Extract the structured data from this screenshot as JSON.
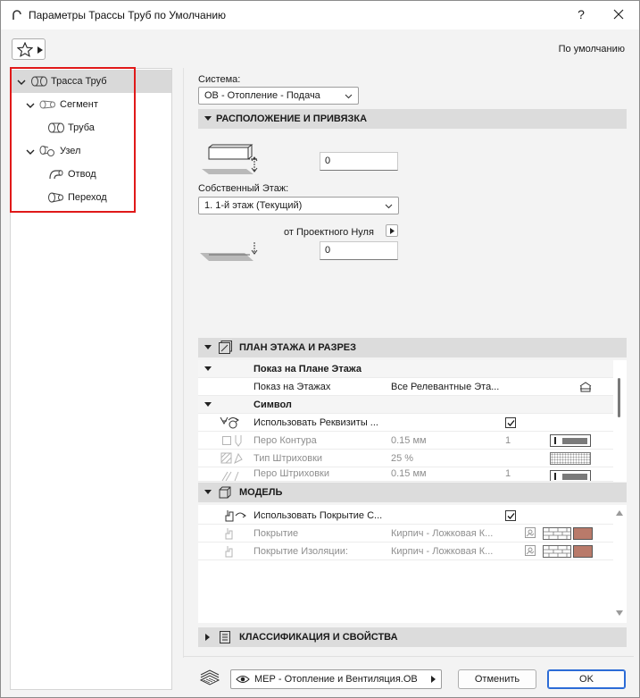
{
  "window": {
    "title": "Параметры Трассы Труб по Умолчанию",
    "help_label": "?"
  },
  "header": {
    "default_label": "По умолчанию"
  },
  "tree": {
    "items": [
      {
        "label": "Трасса Труб",
        "level": 0,
        "expanded": true,
        "selected": true
      },
      {
        "label": "Сегмент",
        "level": 1,
        "expanded": true,
        "selected": false
      },
      {
        "label": "Труба",
        "level": 2,
        "expanded": false,
        "selected": false
      },
      {
        "label": "Узел",
        "level": 1,
        "expanded": true,
        "selected": false
      },
      {
        "label": "Отвод",
        "level": 2,
        "expanded": false,
        "selected": false
      },
      {
        "label": "Переход",
        "level": 2,
        "expanded": false,
        "selected": false
      }
    ]
  },
  "system": {
    "label": "Система:",
    "value": "ОВ - Отопление - Подача"
  },
  "placement": {
    "title": "РАСПОЛОЖЕНИЕ И ПРИВЯЗКА",
    "offset_value": "0",
    "home_story_label": "Собственный Этаж:",
    "home_story_value": "1. 1-й этаж (Текущий)",
    "reference_label": "от Проектного Нуля",
    "reference_value": "0"
  },
  "floor_plan": {
    "title": "ПЛАН ЭТАЖА И РАЗРЕЗ",
    "group1": "Показ на Плане Этажа",
    "show_on_stories_label": "Показ на Этажах",
    "show_on_stories_value": "Все Релевантные Эта...",
    "group2": "Символ",
    "use_attrs_label": "Использовать Реквизиты ...",
    "contour_pen_label": "Перо Контура",
    "contour_pen_size": "0.15 мм",
    "contour_pen_index": "1",
    "hatch_type_label": "Тип Штриховки",
    "hatch_type_value": "25 %",
    "hatch_pen_label": "Перо Штриховки",
    "hatch_pen_size": "0.15 мм",
    "hatch_pen_index": "1"
  },
  "model": {
    "title": "МОДЕЛЬ",
    "use_surface_label": "Использовать Покрытие С...",
    "surface_label": "Покрытие",
    "surface_value": "Кирпич - Ложковая К...",
    "insulation_label": "Покрытие Изоляции:",
    "insulation_value": "Кирпич - Ложковая К..."
  },
  "classification": {
    "title": "КЛАССИФИКАЦИЯ И СВОЙСТВА"
  },
  "footer": {
    "layer_value": "МЕР - Отопление и Вентиляция.ОВ",
    "cancel_label": "Отменить",
    "ok_label": "OK"
  },
  "colors": {
    "selected_row": "#d9d9d9",
    "highlight": "#e01919",
    "section_header": "#dcdcdc",
    "brick": "#b97a6a",
    "ok_border": "#2b6bd6"
  }
}
